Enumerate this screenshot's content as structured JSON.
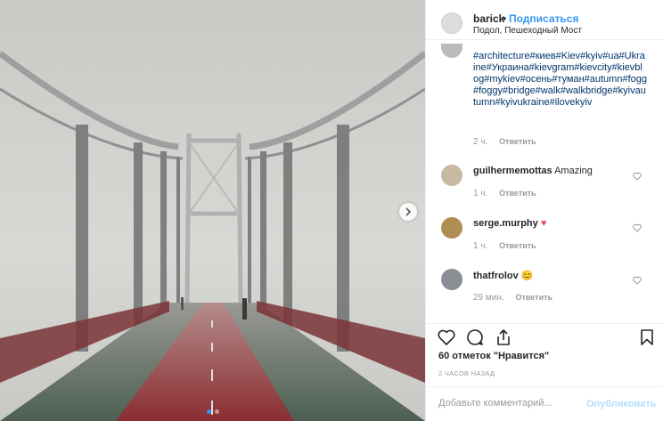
{
  "header": {
    "username": "barick",
    "separator": "•",
    "follow_label": "Подписаться",
    "location": "Подол, Пешеходный Мост"
  },
  "caption": {
    "text": "#architecture#киев#Kiev#kyiv#ua#Ukraine#Украина#kievgram#kievcity#kievblog#mykiev#осень#туман#autumn#fogg#foggy#bridge#walk#walkbridge#kyivautumn#kyivukraine#ilovekyiv",
    "time": "2 ч.",
    "reply_label": "Ответить"
  },
  "comments": [
    {
      "username": "guilhermemottas",
      "text": "Amazing",
      "time": "1 ч.",
      "reply_label": "Ответить"
    },
    {
      "username": "serge.murphy",
      "text": "♥",
      "time": "1 ч.",
      "reply_label": "Ответить"
    },
    {
      "username": "thatfrolov",
      "text": "😊",
      "time": "29 мин.",
      "reply_label": "Ответить"
    }
  ],
  "likes_text": "60 отметок \"Нравится\"",
  "posted_ago": "2 ЧАСОВ НАЗАД",
  "comment_input": {
    "placeholder": "Добавьте комментарий..."
  },
  "publish_label": "Опубликовать",
  "icons": {
    "like": "heart-icon",
    "comment": "comment-icon",
    "share": "share-icon",
    "save": "bookmark-icon",
    "next": "chevron-right-icon"
  },
  "colors": {
    "accent": "#3897f0",
    "hashtag": "#003569",
    "publish_disabled": "#b2dffc",
    "track_red": "#8a2d30"
  }
}
